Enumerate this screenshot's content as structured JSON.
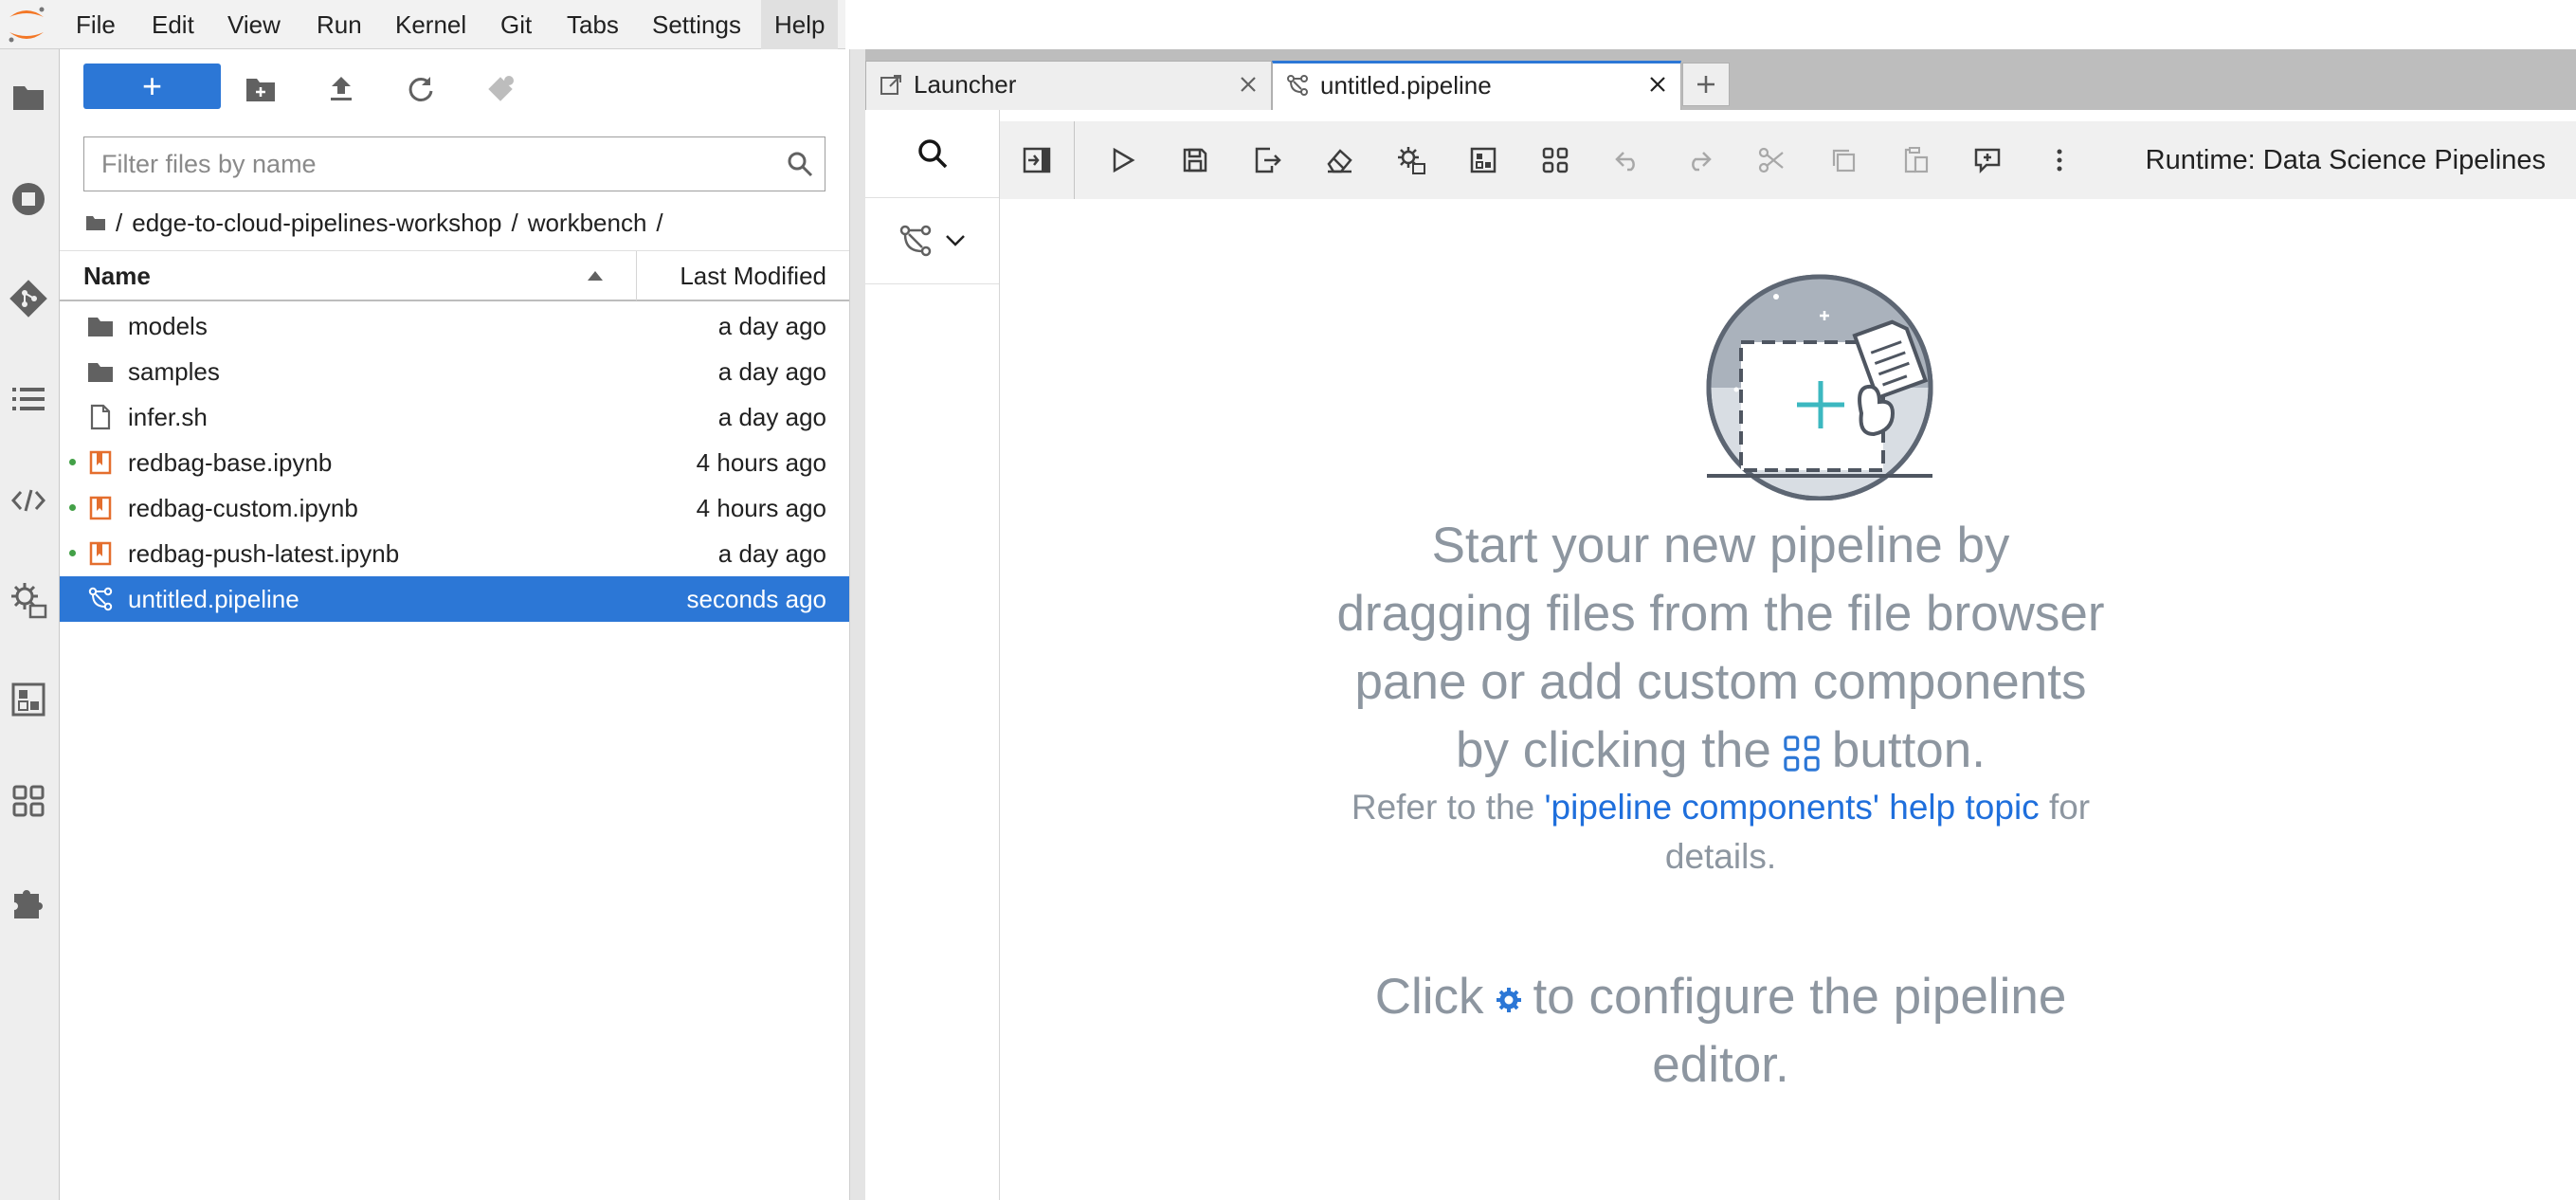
{
  "menu": [
    "File",
    "Edit",
    "View",
    "Run",
    "Kernel",
    "Git",
    "Tabs",
    "Settings",
    "Help"
  ],
  "activity_bar": [
    "folder-icon",
    "running-sessions-icon",
    "git-icon",
    "table-of-contents-icon",
    "code-snippets-icon",
    "runtimes-icon",
    "runtime-images-icon",
    "component-catalogs-icon",
    "extensions-icon"
  ],
  "filebrowser": {
    "new_button": "+",
    "filter_placeholder": "Filter files by name",
    "breadcrumb": [
      "/",
      "edge-to-cloud-pipelines-workshop",
      "/",
      "workbench",
      "/"
    ],
    "col_name": "Name",
    "col_modified": "Last Modified",
    "files": [
      {
        "name": "models",
        "modified": "a day ago",
        "type": "folder",
        "running": false,
        "selected": false
      },
      {
        "name": "samples",
        "modified": "a day ago",
        "type": "folder",
        "running": false,
        "selected": false
      },
      {
        "name": "infer.sh",
        "modified": "a day ago",
        "type": "file",
        "running": false,
        "selected": false
      },
      {
        "name": "redbag-base.ipynb",
        "modified": "4 hours ago",
        "type": "notebook",
        "running": true,
        "selected": false
      },
      {
        "name": "redbag-custom.ipynb",
        "modified": "4 hours ago",
        "type": "notebook",
        "running": true,
        "selected": false
      },
      {
        "name": "redbag-push-latest.ipynb",
        "modified": "a day ago",
        "type": "notebook",
        "running": true,
        "selected": false
      },
      {
        "name": "untitled.pipeline",
        "modified": "seconds ago",
        "type": "pipeline",
        "running": false,
        "selected": true
      }
    ]
  },
  "tabs": [
    {
      "label": "Launcher",
      "icon": "launcher-icon",
      "current": false
    },
    {
      "label": "untitled.pipeline",
      "icon": "pipeline-icon",
      "current": true
    }
  ],
  "editor": {
    "runtime_label": "Runtime: Data Science Pipelines",
    "empty_line1": "Start your new pipeline by",
    "empty_line2": "dragging files from the file browser",
    "empty_line3": "pane or add custom components",
    "empty_line4a": "by clicking the",
    "empty_line4b": "button.",
    "help_prefix": "Refer to the",
    "help_link": "'pipeline components' help topic",
    "help_suffix": "for",
    "help_line2": "details.",
    "config_prefix": "Click",
    "config_suffix": "to configure the pipeline",
    "config_line2": "editor."
  },
  "colors": {
    "accent": "#2c77d6",
    "notebook": "#e46e2e",
    "running": "#43a047",
    "empty_text": "#8d96a0",
    "link": "#1f6fdc"
  }
}
